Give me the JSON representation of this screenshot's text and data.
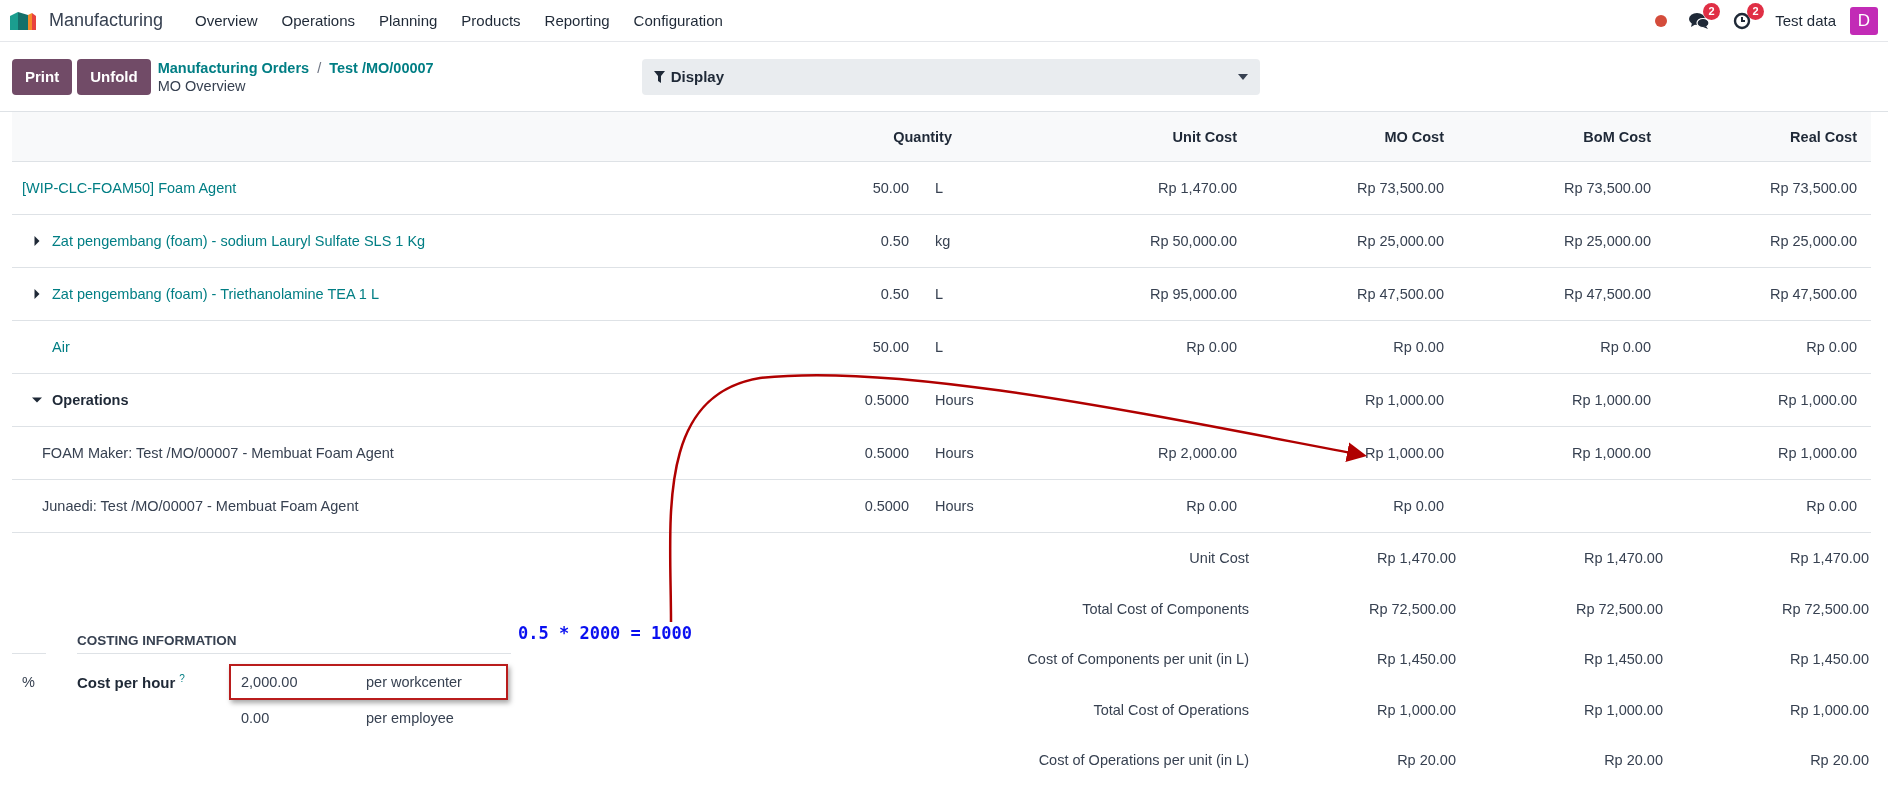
{
  "app": {
    "name": "Manufacturing",
    "menu": [
      "Overview",
      "Operations",
      "Planning",
      "Products",
      "Reporting",
      "Configuration"
    ]
  },
  "systray": {
    "messages_badge": "2",
    "activities_badge": "2",
    "user": "Test data",
    "avatar_initial": "D"
  },
  "control_panel": {
    "buttons": [
      "Print",
      "Unfold"
    ],
    "breadcrumbs": [
      "Manufacturing Orders",
      "Test /MO/00007"
    ],
    "breadcrumb_separator": "/",
    "subtitle": "MO Overview",
    "display_button": "Display"
  },
  "table": {
    "columns": [
      "Quantity",
      "Unit Cost",
      "MO Cost",
      "BoM Cost",
      "Real Cost"
    ],
    "rows": [
      {
        "kind": "product",
        "name": "[WIP-CLC-FOAM50] Foam Agent",
        "quantity": "50.00",
        "uom": "L",
        "unit_cost": "Rp 1,470.00",
        "mo_cost": "Rp 73,500.00",
        "bom_cost": "Rp 73,500.00",
        "real_cost": "Rp 73,500.00"
      },
      {
        "kind": "component",
        "name": "Zat pengembang (foam) - sodium Lauryl Sulfate SLS 1 Kg",
        "expanded": false,
        "quantity": "0.50",
        "uom": "kg",
        "unit_cost": "Rp 50,000.00",
        "mo_cost": "Rp 25,000.00",
        "bom_cost": "Rp 25,000.00",
        "real_cost": "Rp 25,000.00"
      },
      {
        "kind": "component",
        "name": "Zat pengembang (foam) - Triethanolamine TEA 1 L",
        "expanded": false,
        "quantity": "0.50",
        "uom": "L",
        "unit_cost": "Rp 95,000.00",
        "mo_cost": "Rp 47,500.00",
        "bom_cost": "Rp 47,500.00",
        "real_cost": "Rp 47,500.00"
      },
      {
        "kind": "component",
        "name": "Air",
        "quantity": "50.00",
        "uom": "L",
        "unit_cost": "Rp 0.00",
        "mo_cost": "Rp 0.00",
        "bom_cost": "Rp 0.00",
        "real_cost": "Rp 0.00"
      },
      {
        "kind": "section",
        "name": "Operations",
        "expanded": true,
        "quantity": "0.5000",
        "uom": "Hours",
        "mo_cost": "Rp 1,000.00",
        "bom_cost": "Rp 1,000.00",
        "real_cost": "Rp 1,000.00"
      },
      {
        "kind": "operation",
        "name": "FOAM Maker: Test /MO/00007 - Membuat Foam Agent",
        "quantity": "0.5000",
        "uom": "Hours",
        "unit_cost": "Rp 2,000.00",
        "mo_cost": "Rp 1,000.00",
        "bom_cost": "Rp 1,000.00",
        "real_cost": "Rp 1,000.00"
      },
      {
        "kind": "operation",
        "name": "Junaedi: Test /MO/00007 - Membuat Foam Agent",
        "quantity": "0.5000",
        "uom": "Hours",
        "unit_cost": "Rp 0.00",
        "mo_cost": "Rp 0.00",
        "real_cost": "Rp 0.00"
      }
    ],
    "summary": [
      {
        "label": "Unit Cost",
        "mo_cost": "Rp 1,470.00",
        "bom_cost": "Rp 1,470.00",
        "real_cost": "Rp 1,470.00"
      },
      {
        "label": "Total Cost of Components",
        "mo_cost": "Rp 72,500.00",
        "bom_cost": "Rp 72,500.00",
        "real_cost": "Rp 72,500.00"
      },
      {
        "label": "Cost of Components per unit (in L)",
        "mo_cost": "Rp 1,450.00",
        "bom_cost": "Rp 1,450.00",
        "real_cost": "Rp 1,450.00"
      },
      {
        "label": "Total Cost of Operations",
        "mo_cost": "Rp 1,000.00",
        "bom_cost": "Rp 1,000.00",
        "real_cost": "Rp 1,000.00"
      },
      {
        "label": "Cost of Operations per unit (in L)",
        "mo_cost": "Rp 20.00",
        "bom_cost": "Rp 20.00",
        "real_cost": "Rp 20.00"
      }
    ]
  },
  "costing_info": {
    "side_mark": "%",
    "title": "COSTING INFORMATION",
    "label": "Cost per hour",
    "help_mark": "?",
    "rates": [
      {
        "value": "2,000.00",
        "unit": "per workcenter",
        "highlighted": true
      },
      {
        "value": "0.00",
        "unit": "per employee",
        "highlighted": false
      }
    ]
  },
  "annotation": {
    "text": "0.5 * 2000 = 1000"
  }
}
